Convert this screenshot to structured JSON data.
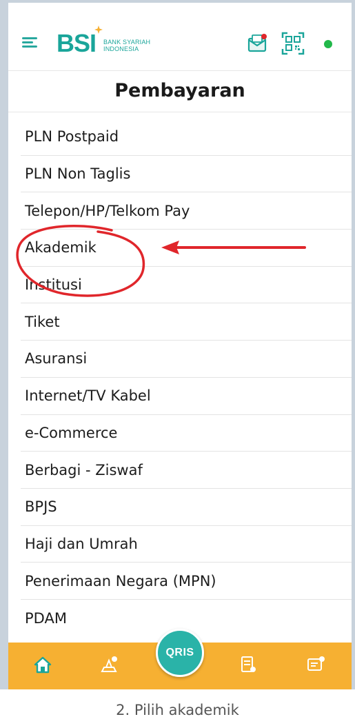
{
  "header": {
    "logo_text": "BSI",
    "logo_subtitle_line1": "BANK SYARIAH",
    "logo_subtitle_line2": "INDONESIA",
    "status": "online"
  },
  "page": {
    "title": "Pembayaran"
  },
  "menu": {
    "items": [
      {
        "label": "PLN Postpaid"
      },
      {
        "label": "PLN Non Taglis"
      },
      {
        "label": "Telepon/HP/Telkom Pay"
      },
      {
        "label": "Akademik"
      },
      {
        "label": "Institusi"
      },
      {
        "label": "Tiket"
      },
      {
        "label": "Asuransi"
      },
      {
        "label": "Internet/TV Kabel"
      },
      {
        "label": "e-Commerce"
      },
      {
        "label": "Berbagi - Ziswaf"
      },
      {
        "label": "BPJS"
      },
      {
        "label": "Haji dan Umrah"
      },
      {
        "label": "Penerimaan Negara (MPN)"
      },
      {
        "label": "PDAM"
      }
    ]
  },
  "bottom_nav": {
    "qris_label": "QRIS",
    "icons": [
      "home-icon",
      "payment-hand-icon",
      "transaction-history-icon",
      "inbox-icon"
    ]
  },
  "annotation": {
    "highlighted_item": "Akademik"
  },
  "colors": {
    "brand": "#1aa59a",
    "bottom_nav": "#f6b032",
    "annotation": "#e0262b",
    "status_dot": "#22b84a"
  },
  "caption": "2. Pilih akademik"
}
